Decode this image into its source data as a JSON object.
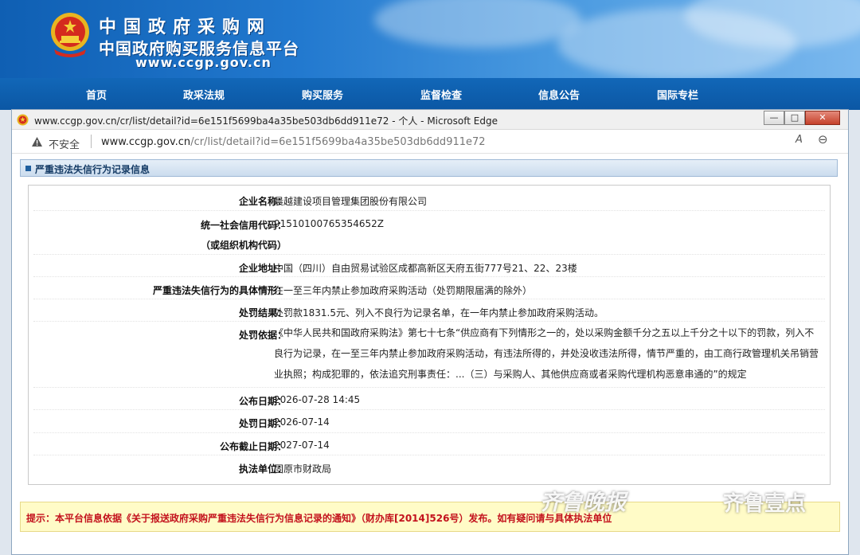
{
  "site": {
    "title_main": "中国政府采购网",
    "title_sub": "中国政府购买服务信息平台",
    "url": "www.ccgp.gov.cn"
  },
  "nav": [
    "首页",
    "政采法规",
    "购买服务",
    "监督检查",
    "信息公告",
    "国际专栏"
  ],
  "browser": {
    "window_title": "www.ccgp.gov.cn/cr/list/detail?id=6e151f5699ba4a35be503db6dd911e72 - 个人 - Microsoft Edge",
    "security_label": "不安全",
    "url_host": "www.ccgp.gov.cn",
    "url_path": "/cr/list/detail?id=6e151f5699ba4a35be503db6dd911e72",
    "minimize": "—",
    "maximize": "□",
    "close": "✕",
    "read_aloud": "A",
    "zoom": "⊖"
  },
  "panel": {
    "title": "严重违法失信行为记录信息"
  },
  "record": {
    "company_label": "企业名称：",
    "company": "晨越建设项目管理集团股份有限公司",
    "credit_label_1": "统一社会信用代码：",
    "credit_label_2": "（或组织机构代码）",
    "credit_code": "91510100765354652Z",
    "address_label": "企业地址：",
    "address": "中国（四川）自由贸易试验区成都高新区天府五街777号21、22、23楼",
    "situation_label": "严重违法失信行为的具体情形：",
    "situation": "在一至三年内禁止参加政府采购活动（处罚期限届满的除外）",
    "result_label": "处罚结果：",
    "result": "处罚款1831.5元、列入不良行为记录名单，在一年内禁止参加政府采购活动。",
    "basis_label": "处罚依据：",
    "basis": "《中华人民共和国政府采购法》第七十七条“供应商有下列情形之一的，处以采购金额千分之五以上千分之十以下的罚款，列入不良行为记录，在一至三年内禁止参加政府采购活动，有违法所得的，并处没收违法所得，情节严重的，由工商行政管理机关吊销营业执照；构成犯罪的，依法追究刑事责任：...（三）与采购人、其他供应商或者采购代理机构恶意串通的”的规定",
    "publish_label": "公布日期：",
    "publish_date": "2026-07-28 14:45",
    "penalty_label": "处罚日期：",
    "penalty_date": "2026-07-14",
    "deadline_label": "公布截止日期：",
    "deadline": "2027-07-14",
    "agency_label": "执法单位：",
    "agency": "固原市财政局"
  },
  "tip": "提示：本平台信息依据《关于报送政府采购严重违法失信行为信息记录的通知》（财办库[2014]526号）发布。如有疑问请与具体执法单位",
  "watermark": {
    "left": "齐鲁晚报",
    "right": "齐鲁壹点"
  },
  "colors": {
    "header_blue": "#1267b8",
    "tip_red": "#c3121d",
    "tip_bg": "#fffbc7"
  }
}
